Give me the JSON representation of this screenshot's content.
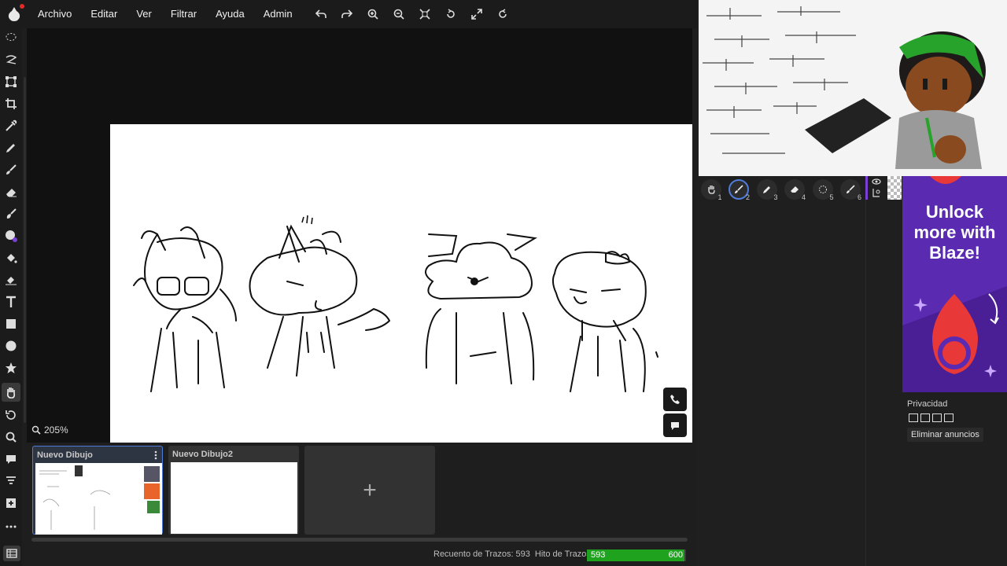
{
  "menu": {
    "items": [
      "Archivo",
      "Editar",
      "Ver",
      "Filtrar",
      "Ayuda",
      "Admin"
    ]
  },
  "toolbar_icons": [
    "undo-icon",
    "redo-icon",
    "zoom-in-icon",
    "zoom-out-icon",
    "fit-icon",
    "rotate-icon",
    "fullscreen-icon",
    "reset-rotation-icon"
  ],
  "tools": [
    "lasso-select",
    "free-transform-lasso",
    "transform",
    "crop",
    "eyedropper",
    "pen",
    "brush",
    "eraser",
    "smudge",
    "fill",
    "gradient",
    "text",
    "rectangle",
    "ellipse",
    "shape",
    "hand",
    "undo",
    "zoom",
    "comment",
    "filter",
    "add",
    "more"
  ],
  "workspace": {
    "zoom_label": "205%"
  },
  "documents": [
    {
      "title": "Nuevo Dibujo",
      "selected": true
    },
    {
      "title": "Nuevo Dibujo2",
      "selected": false
    }
  ],
  "add_document_label": "+",
  "status": {
    "stroke_count_label": "Recuento de Trazos: 593",
    "stroke_milestone_label": "Hito de Trazos:",
    "current": "593",
    "target": "600",
    "progress_fraction": 0.988
  },
  "brush_slots": [
    {
      "num": "1",
      "icon": "hand-icon"
    },
    {
      "num": "2",
      "icon": "brush-icon"
    },
    {
      "num": "3",
      "icon": "pen-icon"
    },
    {
      "num": "4",
      "icon": "eraser-icon"
    },
    {
      "num": "5",
      "icon": "lasso-icon"
    },
    {
      "num": "6",
      "icon": "brush-icon"
    }
  ],
  "ad": {
    "headline": "Unlock more with Blaze!"
  },
  "privacy": {
    "label": "Privacidad",
    "remove_ads": "Eliminar anuncios"
  },
  "colors": {
    "accent": "#4f7bd9",
    "progress": "#1fa31f",
    "ad_bg": "#5a2bb0"
  }
}
